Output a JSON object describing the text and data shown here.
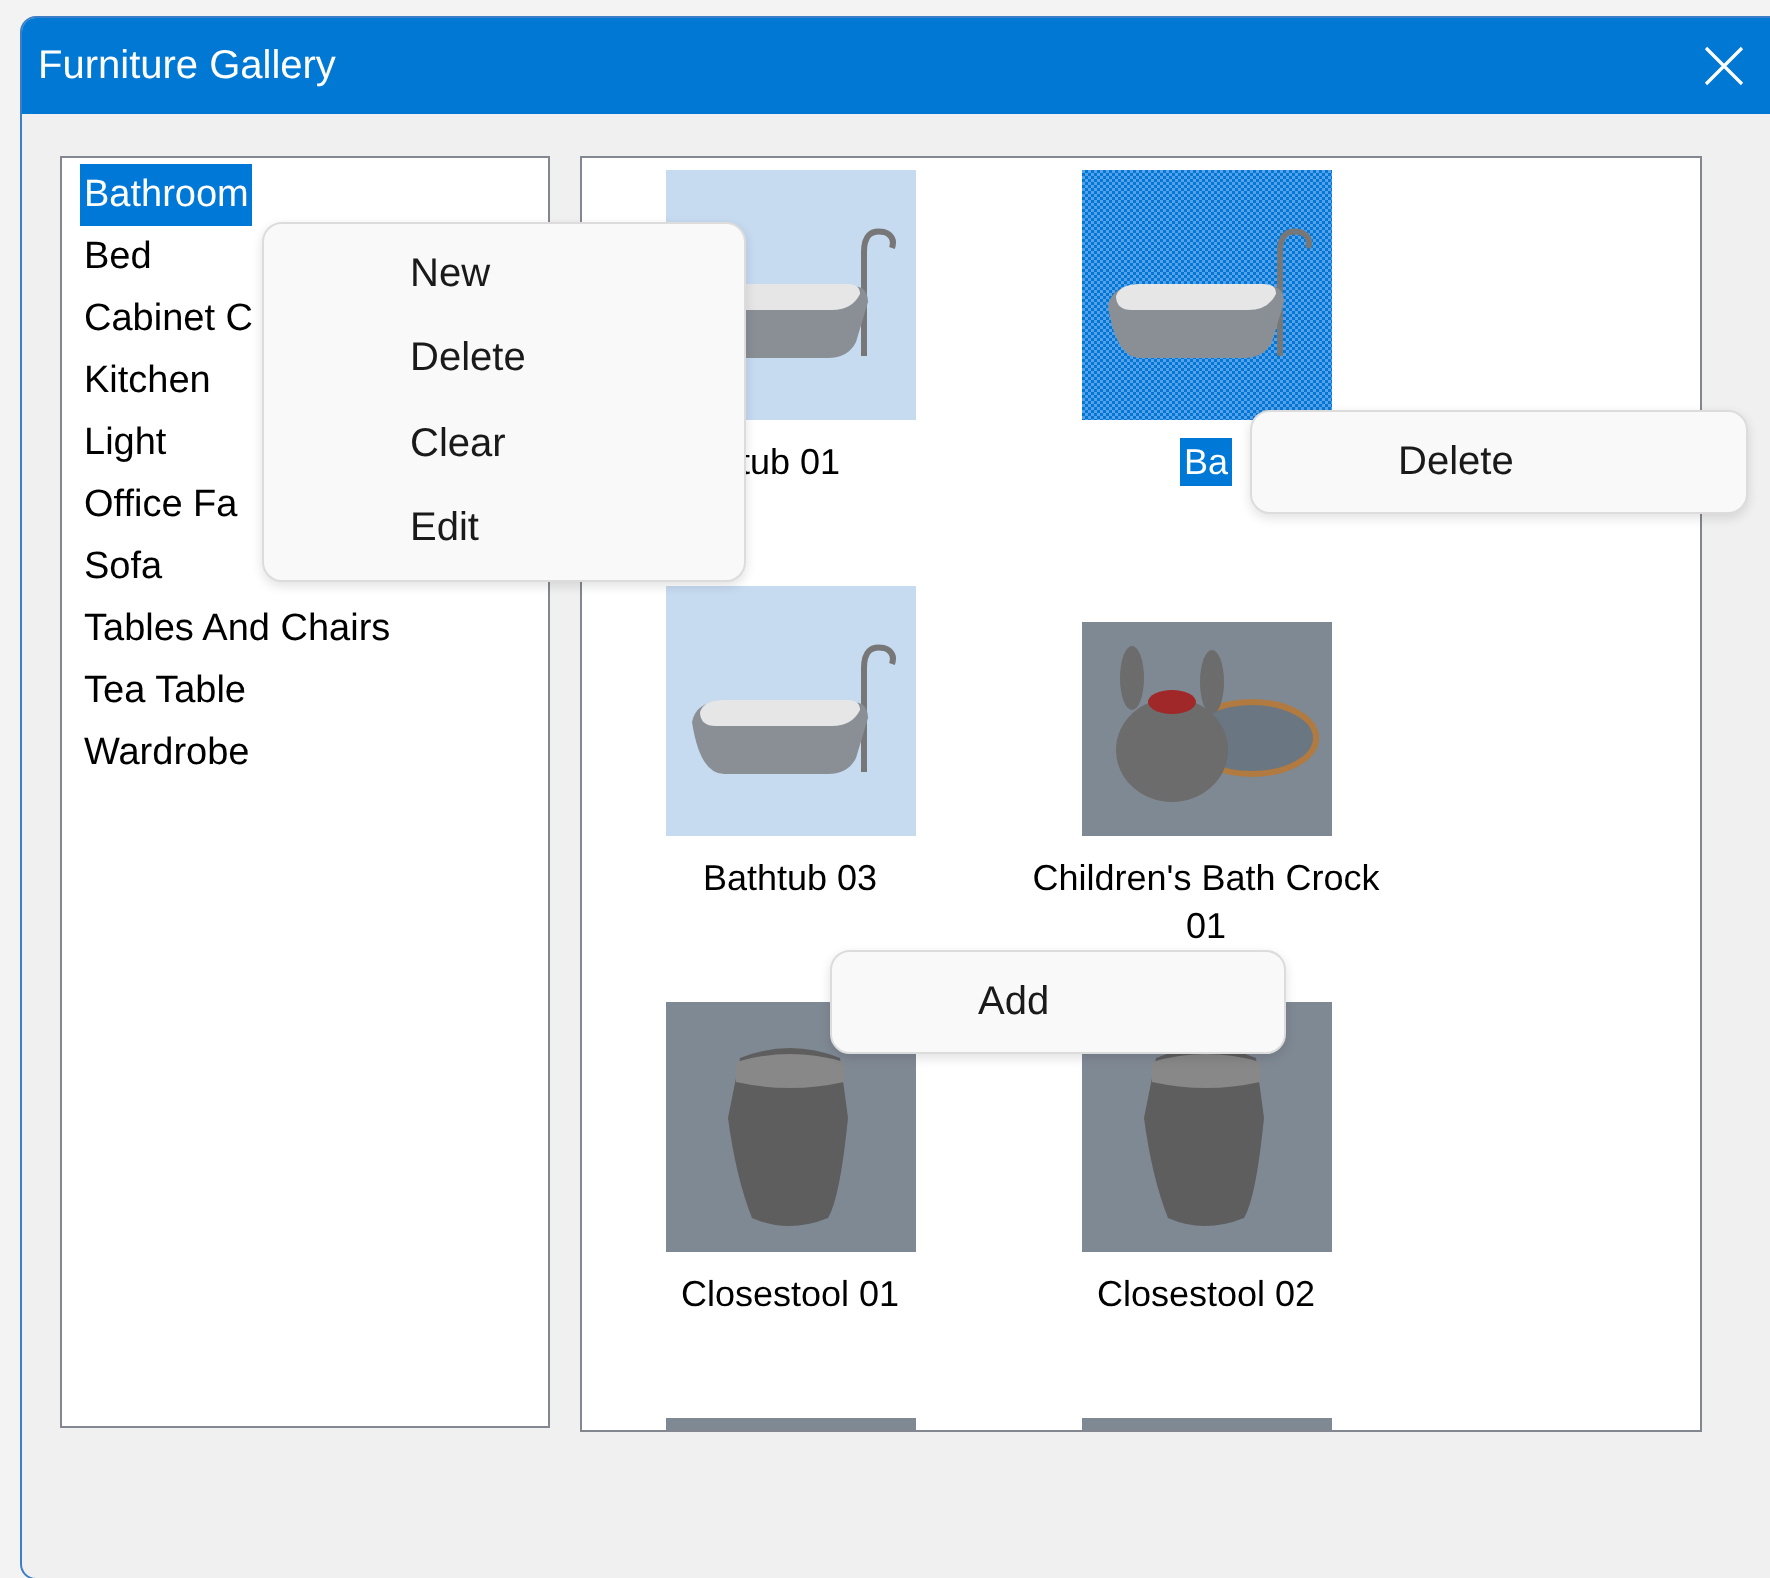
{
  "window": {
    "title": "Furniture Gallery"
  },
  "categories": [
    {
      "label": "Bathroom",
      "selected": true
    },
    {
      "label": "Bed",
      "selected": false
    },
    {
      "label": "Cabinet C",
      "selected": false
    },
    {
      "label": "Kitchen",
      "selected": false
    },
    {
      "label": "Light",
      "selected": false
    },
    {
      "label": "Office Fa",
      "selected": false
    },
    {
      "label": "Sofa",
      "selected": false
    },
    {
      "label": "Tables And Chairs",
      "selected": false
    },
    {
      "label": "Tea Table",
      "selected": false
    },
    {
      "label": "Wardrobe",
      "selected": false
    }
  ],
  "gallery": [
    {
      "kind": "bathtub",
      "name": "tub 01",
      "selected": false
    },
    {
      "kind": "bathtub",
      "name": "Ba",
      "selected": true
    },
    {
      "kind": "bathtub",
      "name": "Bathtub 03",
      "selected": false
    },
    {
      "kind": "crock",
      "name": "Children's Bath Crock 01",
      "selected": false
    },
    {
      "kind": "toilet",
      "name": "Closestool 01",
      "selected": false
    },
    {
      "kind": "toilet",
      "name": "Closestool 02",
      "selected": false
    },
    {
      "kind": "cut",
      "selected": false
    },
    {
      "kind": "cut",
      "selected": false
    }
  ],
  "category_menu": {
    "items": [
      "New",
      "Delete",
      "Clear",
      "Edit"
    ]
  },
  "item_menu": {
    "items": [
      "Delete"
    ]
  },
  "gallery_menu": {
    "items": [
      "Add"
    ]
  }
}
